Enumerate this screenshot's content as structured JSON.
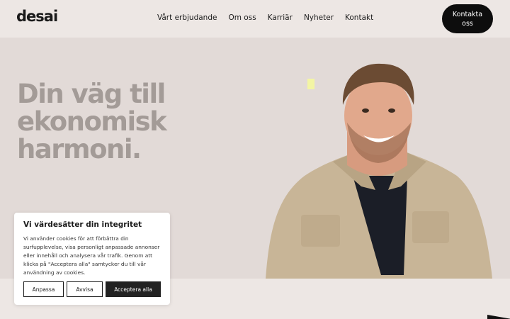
{
  "brand": {
    "logo_text": "desai"
  },
  "nav": {
    "items": [
      {
        "label": "Vårt erbjudande"
      },
      {
        "label": "Om oss"
      },
      {
        "label": "Karriär"
      },
      {
        "label": "Nyheter"
      },
      {
        "label": "Kontakt"
      }
    ],
    "cta_label": "Kontakta oss"
  },
  "hero": {
    "title_lines": [
      "Din väg till",
      "ekonomisk",
      "harmoni."
    ],
    "image_icon": "person-portrait"
  },
  "cookie_banner": {
    "title": "Vi värdesätter din integritet",
    "body": "Vi använder cookies för att förbättra din surfupplevelse, visa personligt anpassade annonser eller innehåll och analysera vår trafik. Genom att klicka på \"Acceptera alla\" samtycker du till vår användning av cookies.",
    "buttons": {
      "customize": "Anpassa",
      "reject": "Avvisa",
      "accept": "Acceptera alla"
    }
  },
  "colors": {
    "page_bg": "#ede7e4",
    "hero_bg": "#e2dad7",
    "hero_text": "#a39b97",
    "button_dark": "#0d0d0d",
    "accent_mark": "#f3f5a4"
  }
}
